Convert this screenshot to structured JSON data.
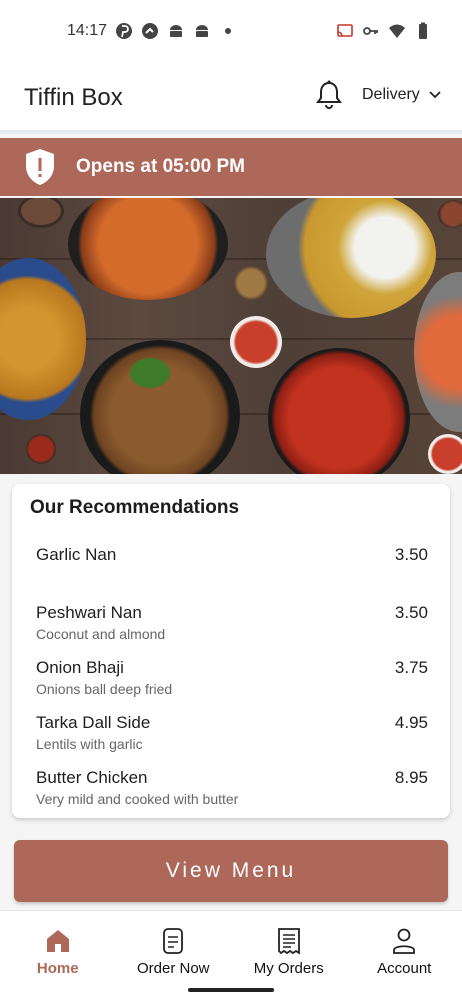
{
  "status_bar": {
    "time": "14:17",
    "left_icons": [
      "pinterest-icon",
      "speed-icon",
      "android-icon",
      "android-icon",
      "dot-icon"
    ],
    "right_icons": [
      "cast-icon",
      "key-icon",
      "wifi-icon",
      "battery-icon"
    ]
  },
  "header": {
    "title": "Tiffin Box",
    "delivery_mode": "Delivery"
  },
  "banner": {
    "text": "Opens at 05:00 PM",
    "icon": "shield-alert-icon"
  },
  "recommendations": {
    "title": "Our Recommendations",
    "items": [
      {
        "name": "Garlic Nan",
        "description": "",
        "price": "3.50"
      },
      {
        "name": "Peshwari Nan",
        "description": "Coconut and almond",
        "price": "3.50"
      },
      {
        "name": "Onion Bhaji",
        "description": "Onions ball deep fried",
        "price": "3.75"
      },
      {
        "name": "Tarka Dall Side",
        "description": "Lentils with garlic",
        "price": "4.95"
      },
      {
        "name": "Butter Chicken",
        "description": "Very mild and cooked with butter",
        "price": "8.95"
      }
    ]
  },
  "view_menu": {
    "label": "View Menu"
  },
  "bottom_nav": {
    "items": [
      {
        "label": "Home",
        "icon": "home-icon",
        "active": true
      },
      {
        "label": "Order Now",
        "icon": "order-icon",
        "active": false
      },
      {
        "label": "My Orders",
        "icon": "receipt-icon",
        "active": false
      },
      {
        "label": "Account",
        "icon": "account-icon",
        "active": false
      }
    ]
  },
  "colors": {
    "accent": "#ad6859",
    "background": "#f5f5f5",
    "card": "#ffffff"
  }
}
